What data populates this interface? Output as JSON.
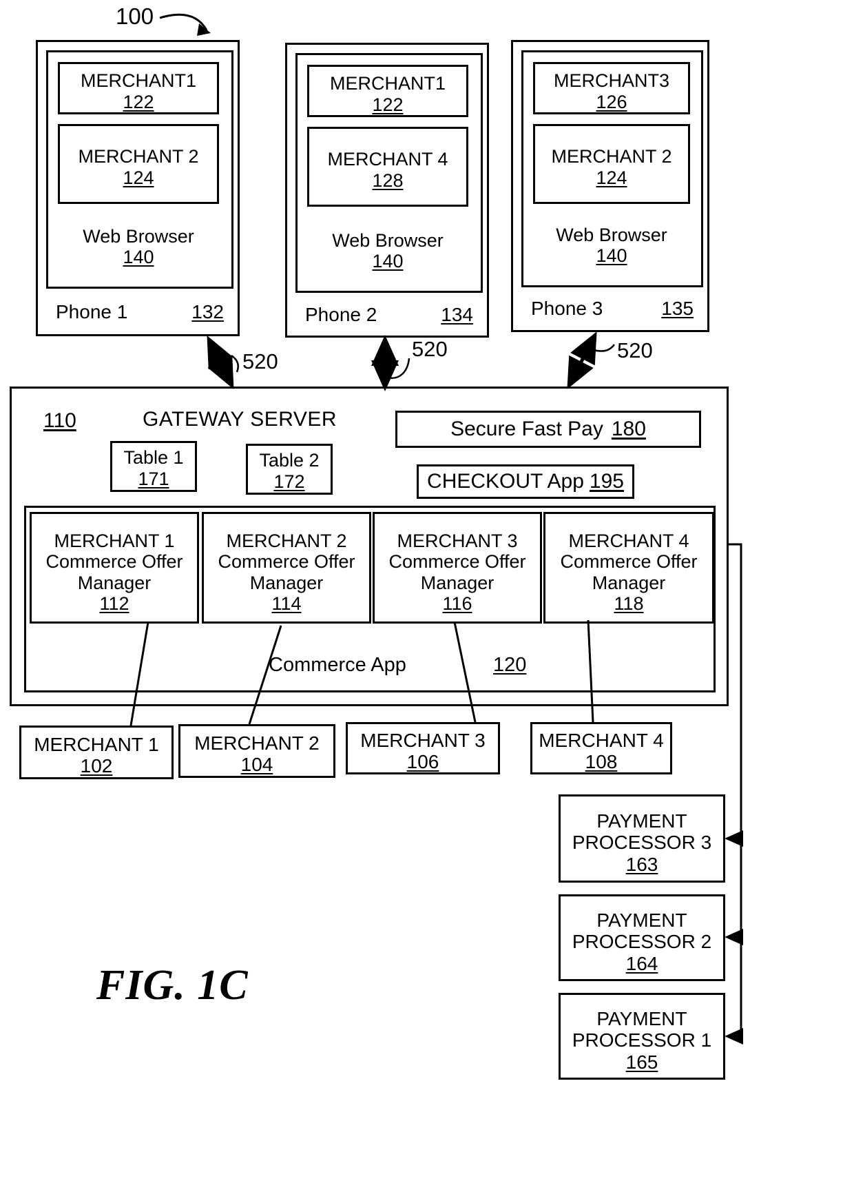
{
  "figure": {
    "system_ref": "100",
    "caption": "FIG. 1C"
  },
  "phones": [
    {
      "name": "Phone 1",
      "ref": "132",
      "apps": [
        {
          "label": "MERCHANT1",
          "ref": "122"
        },
        {
          "label": "MERCHANT 2",
          "ref": "124"
        }
      ],
      "browser": {
        "label": "Web Browser",
        "ref": "140"
      },
      "link_ref": "520"
    },
    {
      "name": "Phone 2",
      "ref": "134",
      "apps": [
        {
          "label": "MERCHANT1",
          "ref": "122"
        },
        {
          "label": "MERCHANT 4",
          "ref": "128"
        }
      ],
      "browser": {
        "label": "Web Browser",
        "ref": "140"
      },
      "link_ref": "520"
    },
    {
      "name": "Phone 3",
      "ref": "135",
      "apps": [
        {
          "label": "MERCHANT3",
          "ref": "126"
        },
        {
          "label": "MERCHANT 2",
          "ref": "124"
        }
      ],
      "browser": {
        "label": "Web Browser",
        "ref": "140"
      },
      "link_ref": "520"
    }
  ],
  "gateway": {
    "ref": "110",
    "title": "GATEWAY SERVER",
    "tables": [
      {
        "label": "Table 1",
        "ref": "171"
      },
      {
        "label": "Table 2",
        "ref": "172"
      }
    ],
    "secure_fast_pay": {
      "label": "Secure Fast Pay",
      "ref": "180"
    },
    "checkout_app": {
      "label": "CHECKOUT  App",
      "ref": "195"
    },
    "commerce_app": {
      "label": "Commerce App",
      "ref": "120"
    },
    "offer_managers": [
      {
        "line1": "MERCHANT 1",
        "line2": "Commerce Offer",
        "line3": "Manager",
        "ref": "112"
      },
      {
        "line1": "MERCHANT 2",
        "line2": "Commerce Offer",
        "line3": "Manager",
        "ref": "114"
      },
      {
        "line1": "MERCHANT 3",
        "line2": "Commerce Offer",
        "line3": "Manager",
        "ref": "116"
      },
      {
        "line1": "MERCHANT 4",
        "line2": "Commerce Offer",
        "line3": "Manager",
        "ref": "118"
      }
    ]
  },
  "merchants": [
    {
      "label": "MERCHANT 1",
      "ref": "102"
    },
    {
      "label": "MERCHANT 2",
      "ref": "104"
    },
    {
      "label": "MERCHANT 3",
      "ref": "106"
    },
    {
      "label": "MERCHANT 4",
      "ref": "108"
    }
  ],
  "payment_processors": [
    {
      "line1": "PAYMENT",
      "line2": "PROCESSOR 3",
      "ref": "163"
    },
    {
      "line1": "PAYMENT",
      "line2": "PROCESSOR 2",
      "ref": "164"
    },
    {
      "line1": "PAYMENT",
      "line2": "PROCESSOR 1",
      "ref": "165"
    }
  ]
}
